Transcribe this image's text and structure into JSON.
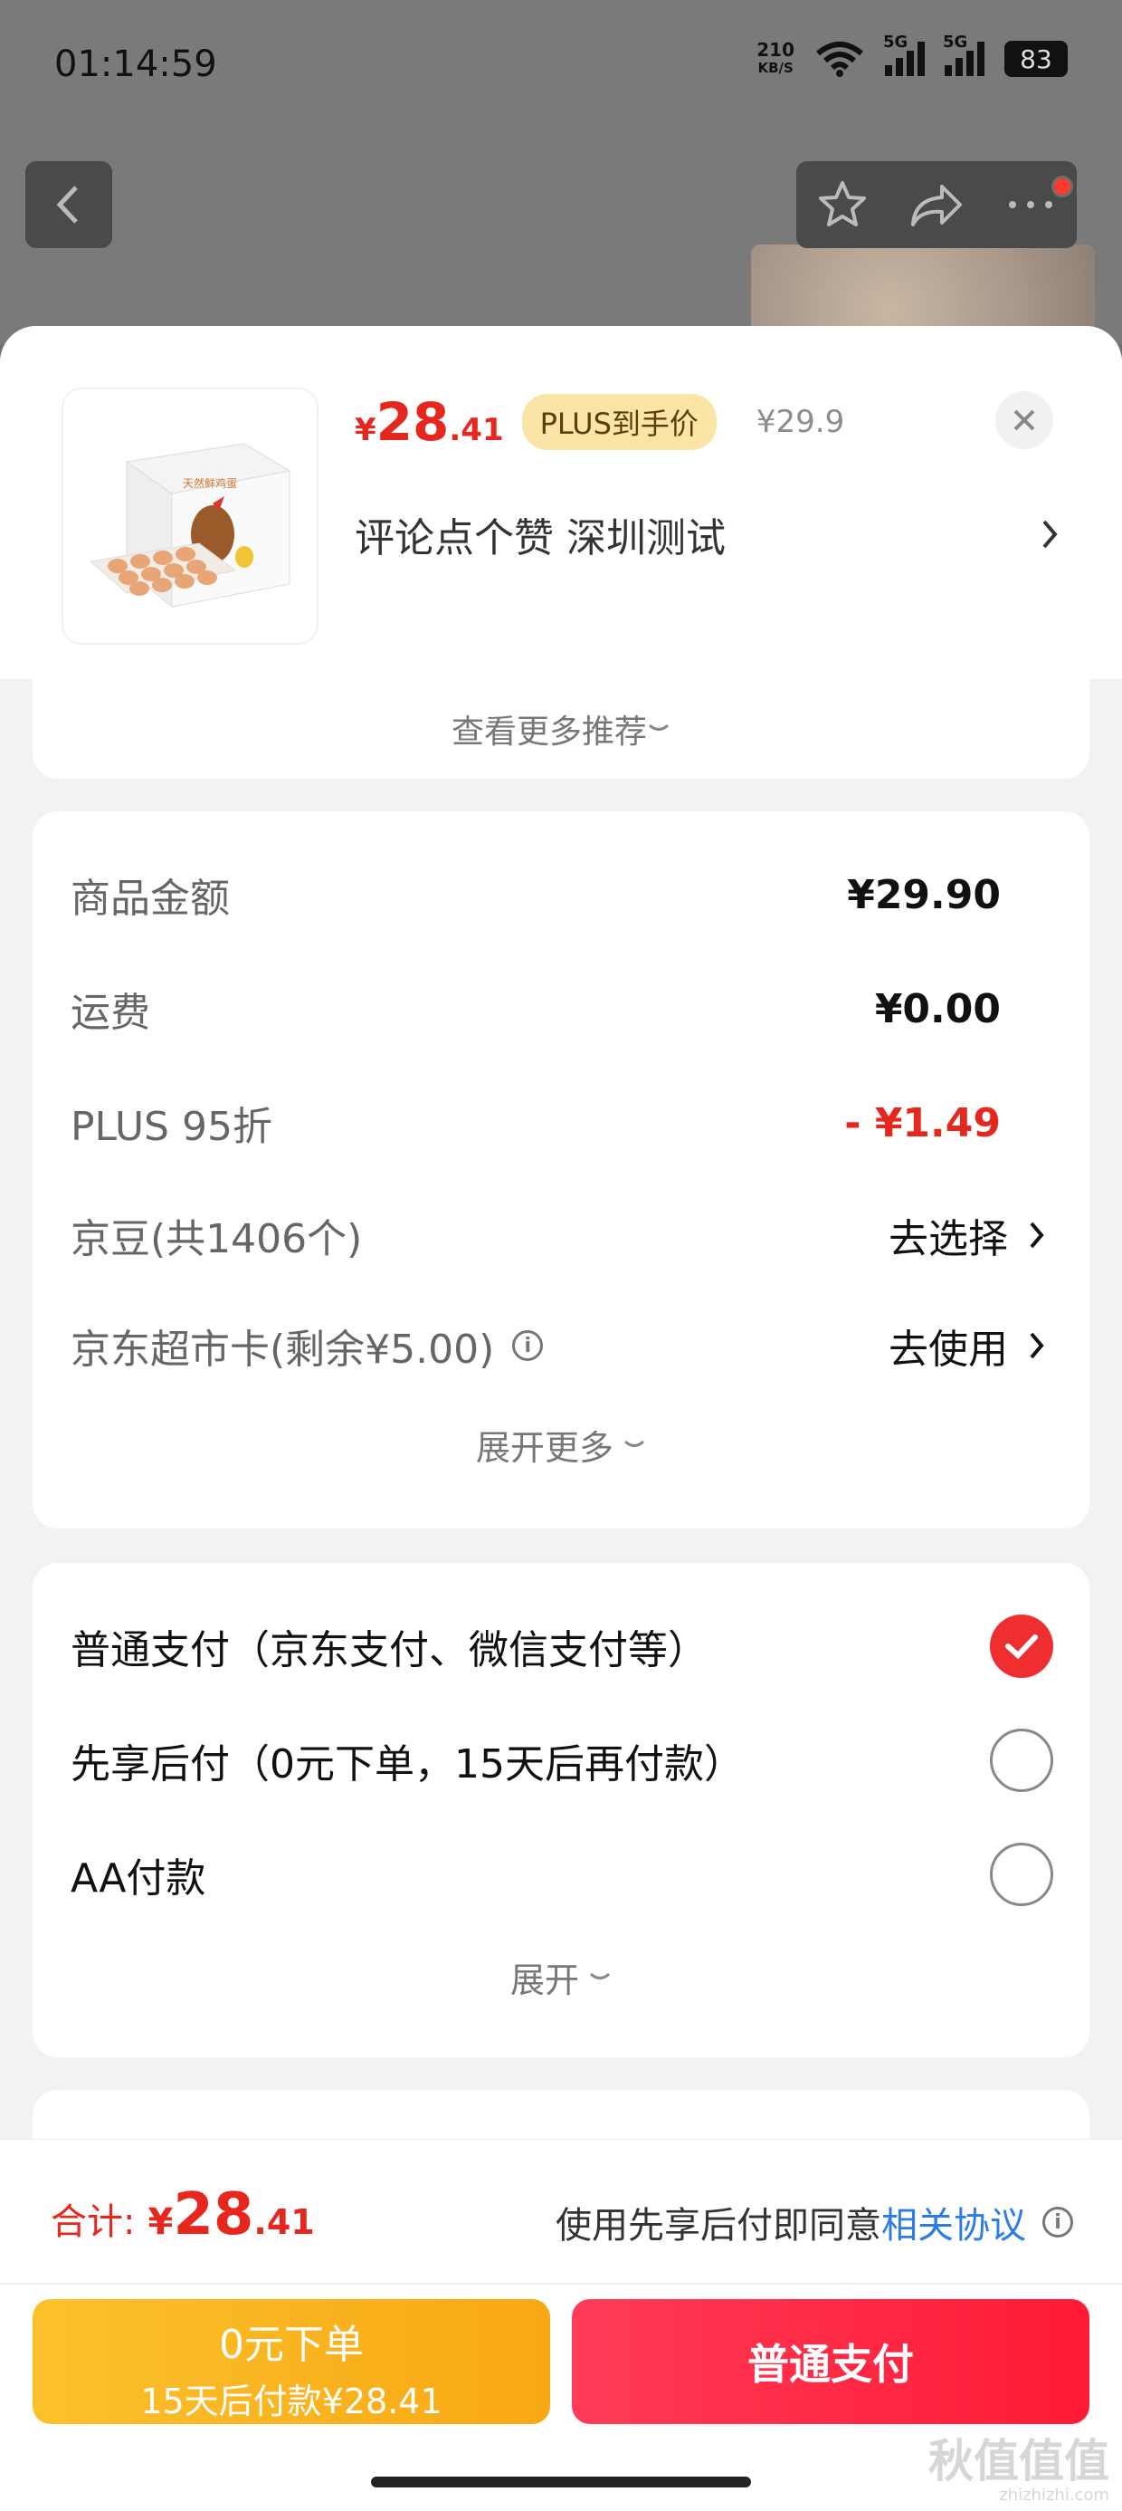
{
  "status_bar": {
    "time": "01:14:59",
    "net_speed": "210",
    "net_unit": "KB/S",
    "signal1_tag": "5G",
    "signal2_tag": "5G",
    "battery": "83"
  },
  "product": {
    "price_symbol": "¥",
    "price_int": "28",
    "price_dec": ".41",
    "plus_tag": "PLUS到手价",
    "original_price": "¥29.9",
    "subtitle": "评论点个赞  深圳测试",
    "thumb_brand_text": "天然鲜鸡蛋"
  },
  "more_recommend": "查看更多推荐",
  "fees": [
    {
      "label": "商品金额",
      "value": "¥29.90"
    },
    {
      "label": "运费",
      "value": "¥0.00"
    },
    {
      "label": "PLUS 95折",
      "value": "- ¥1.49"
    },
    {
      "label": "京豆(共1406个)",
      "action": "去选择"
    },
    {
      "label": "京东超市卡(剩余¥5.00)",
      "action": "去使用"
    }
  ],
  "fees_expand": "展开更多",
  "payment_options": [
    {
      "label": "普通支付（京东支付、微信支付等）",
      "selected": true
    },
    {
      "label": "先享后付（0元下单，15天后再付款）",
      "selected": false
    },
    {
      "label": "AA付款",
      "selected": false
    }
  ],
  "payment_expand": "展开",
  "bottom_bar": {
    "total_label": "合计:",
    "total_symbol": "¥",
    "total_int": "28",
    "total_dec": ".41",
    "agree_text": "使用先享后付即同意",
    "agree_link": "相关协议",
    "bnpl_line1": "0元下单",
    "bnpl_line2": "15天后付款¥28.41",
    "pay_button": "普通支付"
  },
  "watermark": {
    "main": "秋值值值",
    "sub": "zhizhizhi.com"
  },
  "colors": {
    "accent_red": "#e6271e",
    "link_blue": "#2d7ce6",
    "bnpl_yellow": "#f8a814",
    "pay_red": "#ff1a35"
  },
  "icons": [
    "back-arrow-icon",
    "star-icon",
    "share-icon",
    "more-icon",
    "close-icon",
    "chevron-right-icon",
    "chevron-down-icon",
    "info-icon",
    "checkmark-icon",
    "wifi-icon",
    "battery-icon"
  ]
}
